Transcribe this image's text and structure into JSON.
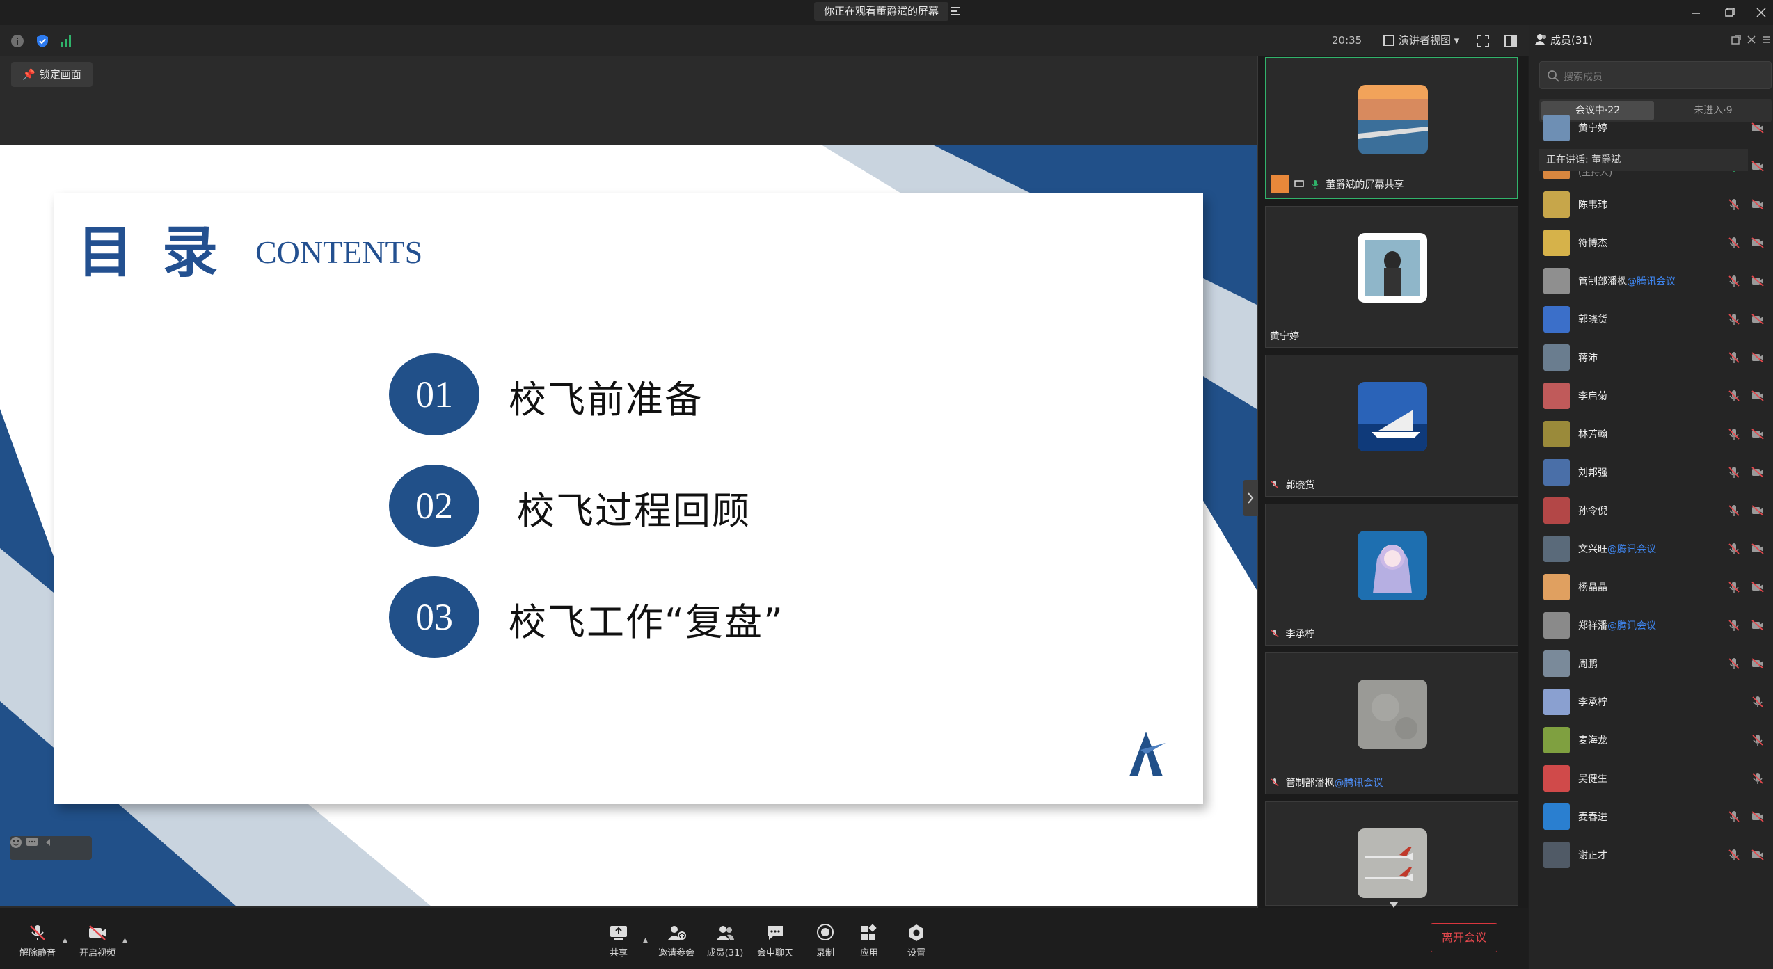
{
  "window": {
    "title": "你正在观看董爵斌的屏幕",
    "time": "20:35",
    "view_mode": "演讲者视图"
  },
  "main": {
    "lock_label": "锁定画面"
  },
  "slide": {
    "title": "目录",
    "subtitle": "CONTENTS",
    "items": [
      {
        "num": "01",
        "text": "校飞前准备"
      },
      {
        "num": "02",
        "text": "校飞过程回顾"
      },
      {
        "num": "03",
        "text": "校飞工作“复盘”"
      }
    ],
    "colors": {
      "primary": "#215089",
      "light": "#c9d4df"
    }
  },
  "gallery": {
    "tiles": [
      {
        "name": "董爵斌的屏幕共享",
        "tag": "",
        "avatar": "sunset-pier",
        "active": true
      },
      {
        "name": "黄宁婷",
        "tag": "",
        "avatar": "girl-portrait",
        "active": false
      },
      {
        "name": "郭晓货",
        "tag": "",
        "avatar": "sailboat",
        "active": false
      },
      {
        "name": "李承柠",
        "tag": "",
        "avatar": "anime-girl",
        "active": false
      },
      {
        "name": "管制部潘枫",
        "tag": "@腾讯会议",
        "avatar": "gray-texture",
        "active": false
      },
      {
        "name": "",
        "tag": "",
        "avatar": "airplanes",
        "active": false
      }
    ]
  },
  "panel": {
    "title": "成员(31)",
    "search_placeholder": "搜索成员",
    "tab_in": "会议中·22",
    "tab_out": "未进入·9",
    "speaking": "正在讲话: 董爵斌",
    "members": [
      {
        "name": "黄宁婷",
        "tag": "",
        "sub": ""
      },
      {
        "name": "董爵斌",
        "tag": "",
        "sub": "(主持人)"
      },
      {
        "name": "陈韦玮",
        "tag": "",
        "sub": ""
      },
      {
        "name": "符博杰",
        "tag": "",
        "sub": ""
      },
      {
        "name": "管制部潘枫",
        "tag": "@腾讯会议",
        "sub": ""
      },
      {
        "name": "郭晓货",
        "tag": "",
        "sub": ""
      },
      {
        "name": "蒋沛",
        "tag": "",
        "sub": ""
      },
      {
        "name": "李启菊",
        "tag": "",
        "sub": ""
      },
      {
        "name": "林芳翰",
        "tag": "",
        "sub": ""
      },
      {
        "name": "刘邦强",
        "tag": "",
        "sub": ""
      },
      {
        "name": "孙令倪",
        "tag": "",
        "sub": ""
      },
      {
        "name": "文兴旺",
        "tag": "@腾讯会议",
        "sub": ""
      },
      {
        "name": "杨晶晶",
        "tag": "",
        "sub": ""
      },
      {
        "name": "郑祥潘",
        "tag": "@腾讯会议",
        "sub": ""
      },
      {
        "name": "周鹏",
        "tag": "",
        "sub": ""
      },
      {
        "name": "李承柠",
        "tag": "",
        "sub": ""
      },
      {
        "name": "麦海龙",
        "tag": "",
        "sub": ""
      },
      {
        "name": "吴健生",
        "tag": "",
        "sub": ""
      },
      {
        "name": "麦春进",
        "tag": "",
        "sub": ""
      },
      {
        "name": "谢正才",
        "tag": "",
        "sub": ""
      }
    ]
  },
  "toolbar": {
    "unmute": "解除静音",
    "start_video": "开启视频",
    "share": "共享",
    "invite": "邀请参会",
    "members": "成员(31)",
    "chat": "会中聊天",
    "record": "录制",
    "apps": "应用",
    "settings": "设置",
    "leave": "离开会议"
  }
}
